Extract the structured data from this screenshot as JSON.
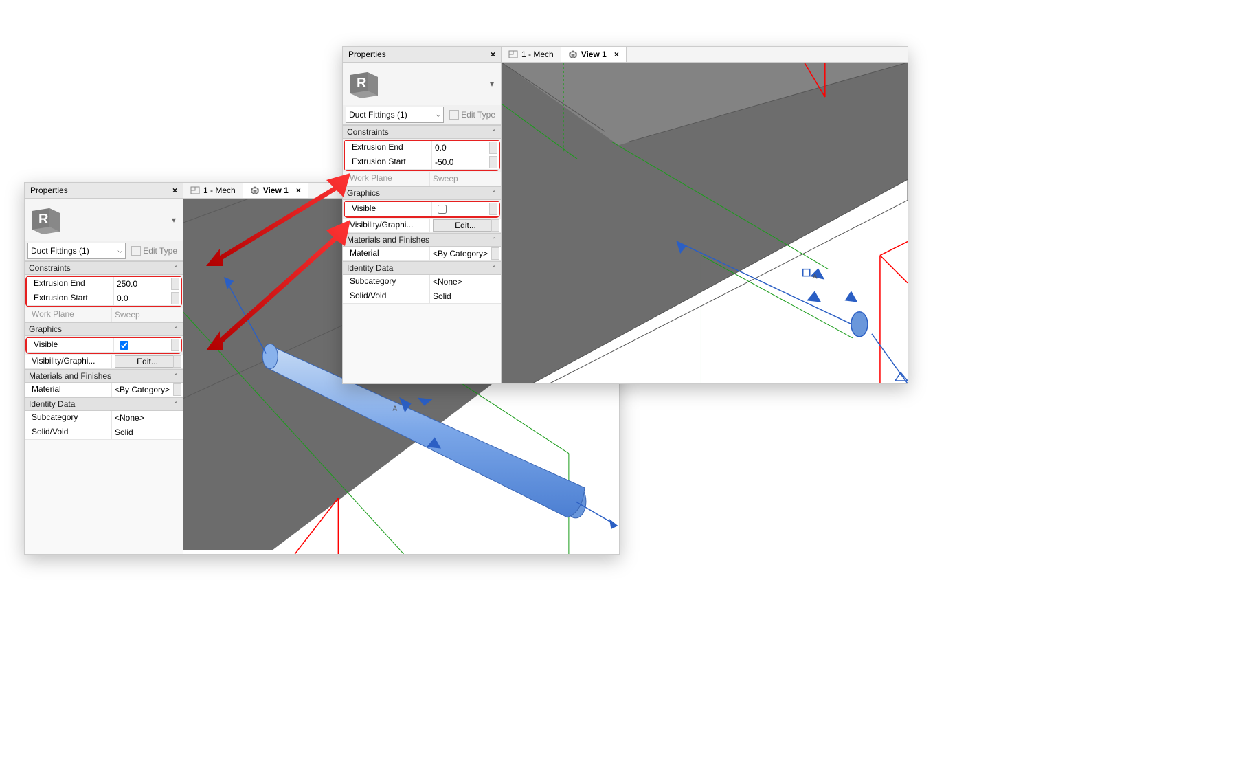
{
  "panelTitle": "Properties",
  "typeSelector": "Duct Fittings (1)",
  "editTypeLabel": "Edit Type",
  "groups": {
    "constraints": "Constraints",
    "graphics": "Graphics",
    "materials": "Materials and Finishes",
    "identity": "Identity Data"
  },
  "labels": {
    "extrusionEnd": "Extrusion End",
    "extrusionStart": "Extrusion Start",
    "workPlane": "Work Plane",
    "visible": "Visible",
    "visGraphics": "Visibility/Graphi...",
    "material": "Material",
    "subcategory": "Subcategory",
    "solidVoid": "Solid/Void"
  },
  "values": {
    "editBtn": "Edit...",
    "byCategory": "<By Category>",
    "none": "<None>",
    "solid": "Solid",
    "sweep": "Sweep"
  },
  "left": {
    "extrusionEnd": "250.0",
    "extrusionStart": "0.0",
    "visibleChecked": true
  },
  "right": {
    "extrusionEnd": "0.0",
    "extrusionStart": "-50.0",
    "visibleChecked": false
  },
  "tabs": {
    "mech": "1 - Mech",
    "view1": "View 1"
  }
}
